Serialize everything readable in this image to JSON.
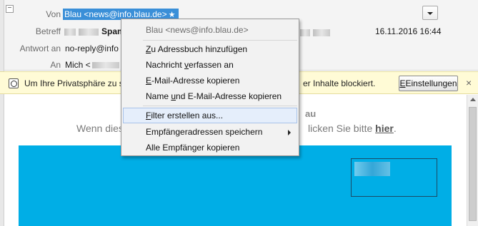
{
  "header": {
    "from_label": "Von",
    "from_value": "Blau <news@info.blau.de>",
    "star_icon": "★",
    "subject_label": "Betreff",
    "subject_value": "Spam",
    "date": "16.11.2016 16:44",
    "reply_to_label": "Antwort an",
    "reply_to_value": "no-reply@info",
    "to_label": "An",
    "to_value": "Mich <"
  },
  "notice": {
    "text_left": "Um Ihre Privatsphäre zu sc",
    "text_right": "er Inhalte blockiert.",
    "settings_button": "Einstellungen",
    "close": "×"
  },
  "body": {
    "line1": "au",
    "line2_left": "Wenn dies",
    "line2_right": "licken Sie bitte",
    "link": "hier",
    "period": "."
  },
  "context_menu": {
    "header": "Blau <news@info.blau.de>",
    "items": [
      {
        "label": "Zu Adressbuch hinzufügen",
        "access": "Z",
        "rest": "u Adressbuch hinzufügen"
      },
      {
        "label": "Nachricht verfassen an",
        "pre": "Nachricht ",
        "access": "v",
        "rest": "erfassen an"
      },
      {
        "label": "E-Mail-Adresse kopieren",
        "access": "E",
        "rest": "-Mail-Adresse kopieren"
      },
      {
        "label": "Name und E-Mail-Adresse kopieren",
        "pre": "Name ",
        "access": "u",
        "rest": "nd E-Mail-Adresse kopieren"
      },
      {
        "label": "Filter erstellen aus...",
        "access": "F",
        "rest": "ilter erstellen aus..."
      },
      {
        "label": "Empfängeradressen speichern",
        "has_submenu": true
      },
      {
        "label": "Alle Empfänger kopieren"
      }
    ]
  },
  "colors": {
    "selection_blue": "#3a8fd8",
    "banner_blue": "#00aee6",
    "notice_yellow": "#fffbd6"
  }
}
